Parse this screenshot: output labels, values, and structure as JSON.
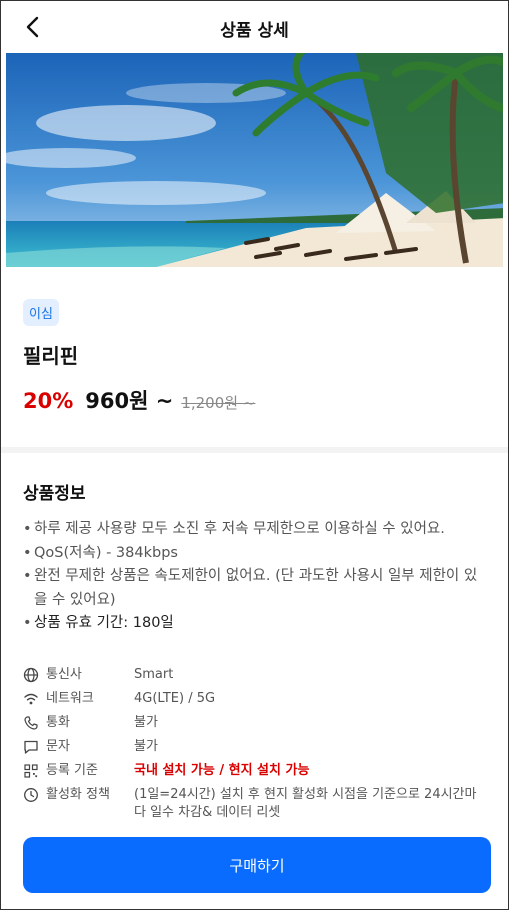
{
  "header": {
    "title": "상품 상세"
  },
  "product": {
    "badge": "이심",
    "name": "필리핀",
    "discount": "20%",
    "price": "960원 ~",
    "original_price": "1,200원 ~"
  },
  "info": {
    "title": "상품정보",
    "bullets": [
      "하루 제공 사용량 모두 소진 후 저속 무제한으로 이용하실 수 있어요.",
      "QoS(저속) - 384kbps",
      "완전 무제한 상품은 속도제한이 없어요. (단 과도한 사용시 일부 제한이 있을 수 있어요)",
      "상품 유효 기간: 180일"
    ]
  },
  "specs": [
    {
      "icon": "globe-icon",
      "label": "통신사",
      "value": "Smart"
    },
    {
      "icon": "wifi-icon",
      "label": "네트워크",
      "value": "4G(LTE) / 5G"
    },
    {
      "icon": "phone-icon",
      "label": "통화",
      "value": "불가"
    },
    {
      "icon": "message-icon",
      "label": "문자",
      "value": "불가"
    },
    {
      "icon": "qr-icon",
      "label": "등록 기준",
      "value": "국내 설치 가능 / 현지 설치 가능"
    },
    {
      "icon": "clock-icon",
      "label": "활성화 정책",
      "value": "(1일=24시간) 설치 후 현지 활성화 시점을 기준으로 24시간마다 일수 차감& 데이터 리셋"
    }
  ],
  "buy_label": "구매하기",
  "colors": {
    "accent": "#0a6cff",
    "discount": "#d90000",
    "badge_bg": "#e3efff"
  }
}
